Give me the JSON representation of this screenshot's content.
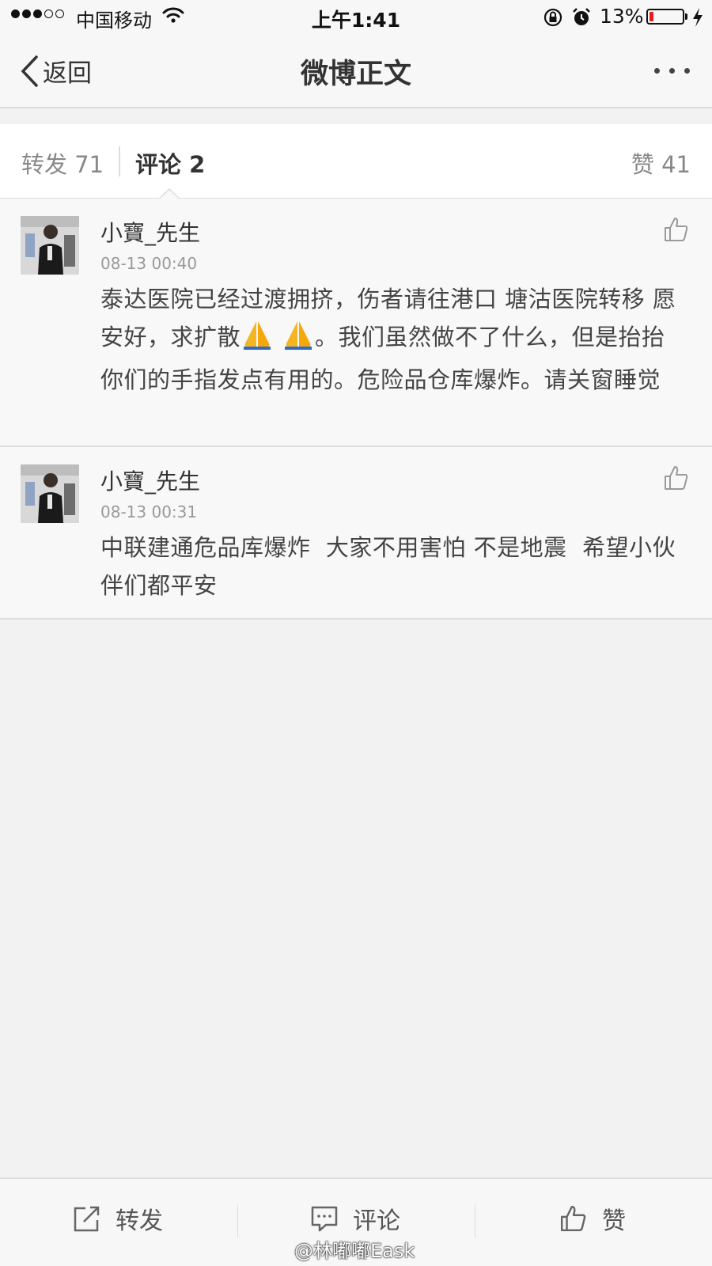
{
  "status_bar": {
    "carrier": "中国移动",
    "time": "上午1:41",
    "battery_percent": "13%",
    "battery_level": 0.13,
    "battery_color": "#e02020",
    "signal_filled": 3,
    "signal_total": 5
  },
  "nav": {
    "back_label": "返回",
    "title": "微博正文",
    "more_icon": "more-dots-icon"
  },
  "tabs": {
    "forward": "转发 71",
    "comment": "评论 2",
    "like": "赞 41"
  },
  "comments": [
    {
      "user": "小寶_先生",
      "time": "08-13 00:40",
      "text_part1": "泰达医院已经过渡拥挤，伤者请往港口 塘沽医院转移 愿安好，求扩散",
      "text_part2": "。我们虽然做不了什么，但是抬抬你们的手指发点有用的。危险品仓库爆炸。请关窗睡觉"
    },
    {
      "user": "小寶_先生",
      "time": "08-13 00:31",
      "text": "中联建通危品库爆炸  大家不用害怕 不是地震  希望小伙伴们都平安"
    }
  ],
  "toolbar": {
    "forward": "转发",
    "comment": "评论",
    "like": "赞"
  },
  "watermark": "@林嘟嘟Eask"
}
